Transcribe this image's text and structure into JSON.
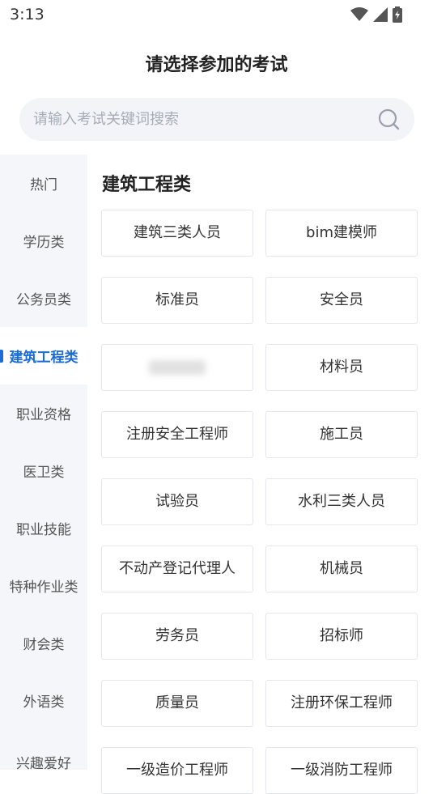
{
  "status_bar": {
    "time": "3:13"
  },
  "page_title": "请选择参加的考试",
  "search": {
    "placeholder": "请输入考试关键词搜索"
  },
  "sidebar": {
    "items": [
      {
        "label": "热门",
        "active": false
      },
      {
        "label": "学历类",
        "active": false
      },
      {
        "label": "公务员类",
        "active": false
      },
      {
        "label": "建筑工程类",
        "active": true
      },
      {
        "label": "职业资格",
        "active": false
      },
      {
        "label": "医卫类",
        "active": false
      },
      {
        "label": "职业技能",
        "active": false
      },
      {
        "label": "特种作业类",
        "active": false
      },
      {
        "label": "财会类",
        "active": false
      },
      {
        "label": "外语类",
        "active": false
      },
      {
        "label": "兴趣爱好",
        "active": false
      }
    ]
  },
  "section": {
    "title": "建筑工程类",
    "exams": [
      "建筑三类人员",
      "bim建模师",
      "标准员",
      "安全员",
      "",
      "材料员",
      "注册安全工程师",
      "施工员",
      "试验员",
      "水利三类人员",
      "不动产登记代理人",
      "机械员",
      "劳务员",
      "招标师",
      "质量员",
      "注册环保工程师",
      "一级造价工程师",
      "一级消防工程师"
    ]
  },
  "colors": {
    "accent": "#1a6dd6",
    "sidebar_bg": "#f4f6fa",
    "search_bg": "#f2f4f8"
  }
}
